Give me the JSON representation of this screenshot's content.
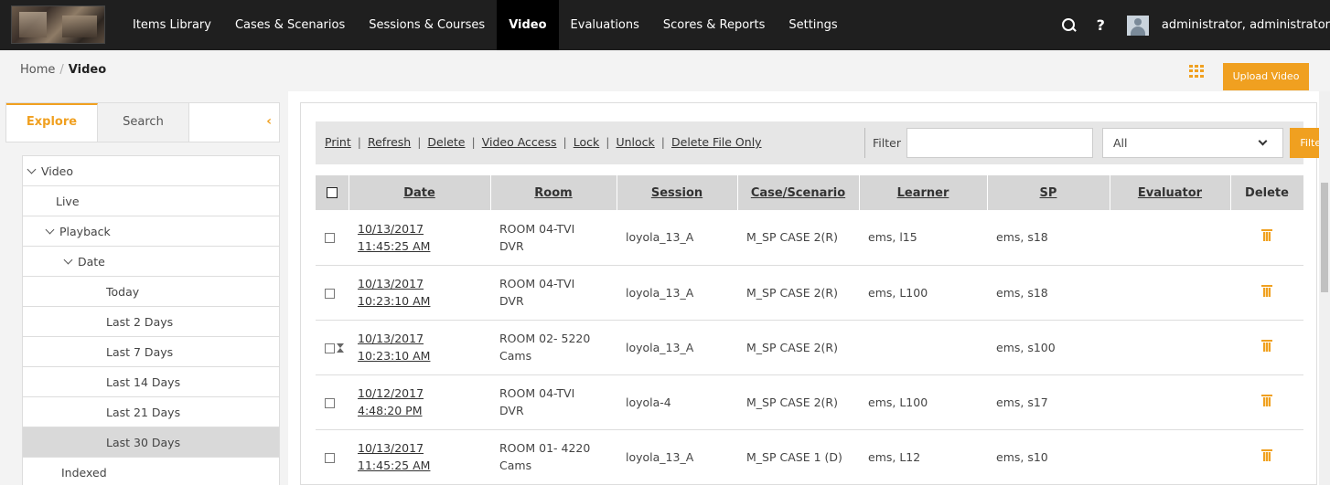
{
  "topbar": {
    "nav": [
      {
        "label": "Items Library"
      },
      {
        "label": "Cases & Scenarios"
      },
      {
        "label": "Sessions & Courses"
      },
      {
        "label": "Video",
        "active": true
      },
      {
        "label": "Evaluations"
      },
      {
        "label": "Scores & Reports"
      },
      {
        "label": "Settings"
      }
    ],
    "help_label": "?",
    "user": "administrator, administrator"
  },
  "breadcrumb": {
    "home": "Home",
    "sep": "/",
    "current": "Video"
  },
  "upload_label": "Upload Video",
  "sidebar": {
    "tabs": [
      {
        "label": "Explore",
        "active": true
      },
      {
        "label": "Search"
      }
    ],
    "collapse_glyph": "‹",
    "tree": [
      {
        "label": "Video",
        "level": 0,
        "expanded": true
      },
      {
        "label": "Live",
        "level": 1
      },
      {
        "label": "Playback",
        "level": 1,
        "expanded": true
      },
      {
        "label": "Date",
        "level": 2,
        "expanded": true
      },
      {
        "label": "Today",
        "level": 3
      },
      {
        "label": "Last 2 Days",
        "level": 3
      },
      {
        "label": "Last 7 Days",
        "level": 3
      },
      {
        "label": "Last 14 Days",
        "level": 3
      },
      {
        "label": "Last 21 Days",
        "level": 3
      },
      {
        "label": "Last 30 Days",
        "level": 3,
        "selected": true
      },
      {
        "label": "Indexed",
        "level": 1
      }
    ]
  },
  "toolbar": {
    "actions": [
      "Print",
      "Refresh",
      "Delete",
      "Video Access",
      "Lock",
      "Unlock",
      "Delete File Only"
    ],
    "filter_label": "Filter",
    "filter_value": "",
    "select_value": "All",
    "filter_button": "Filter"
  },
  "table": {
    "columns": [
      "Date",
      "Room",
      "Session",
      "Case/Scenario",
      "Learner",
      "SP",
      "Evaluator",
      "Delete"
    ],
    "rows": [
      {
        "date": [
          "10/13/2017",
          "11:45:25 AM"
        ],
        "room": [
          "ROOM 04-TVI",
          "DVR"
        ],
        "session": "loyola_13_A",
        "case": "M_SP CASE 2(R)",
        "learner": "ems, l15",
        "sp": "ems, s18",
        "evaluator": "",
        "locked": false
      },
      {
        "date": [
          "10/13/2017",
          "10:23:10 AM"
        ],
        "room": [
          "ROOM 04-TVI",
          "DVR"
        ],
        "session": "loyola_13_A",
        "case": "M_SP CASE 2(R)",
        "learner": "ems, L100",
        "sp": "ems, s18",
        "evaluator": "",
        "locked": false
      },
      {
        "date": [
          "10/13/2017",
          "10:23:10 AM"
        ],
        "room": [
          "ROOM 02- 5220",
          "Cams"
        ],
        "session": "loyola_13_A",
        "case": "M_SP CASE 2(R)",
        "learner": "",
        "sp": "ems, s100",
        "evaluator": "",
        "locked": true
      },
      {
        "date": [
          "10/12/2017",
          "4:48:20 PM"
        ],
        "room": [
          "ROOM 04-TVI",
          "DVR"
        ],
        "session": "loyola-4",
        "case": "M_SP CASE 2(R)",
        "learner": "ems, L100",
        "sp": "ems, s17",
        "evaluator": "",
        "locked": false
      },
      {
        "date": [
          "10/13/2017",
          "11:45:25 AM"
        ],
        "room": [
          "ROOM 01- 4220",
          "Cams"
        ],
        "session": "loyola_13_A",
        "case": "M_SP CASE 1 (D)",
        "learner": "ems, L12",
        "sp": "ems, s10",
        "evaluator": "",
        "locked": false
      }
    ]
  },
  "colors": {
    "accent": "#f0a020",
    "topbar": "#1f1f1f"
  }
}
